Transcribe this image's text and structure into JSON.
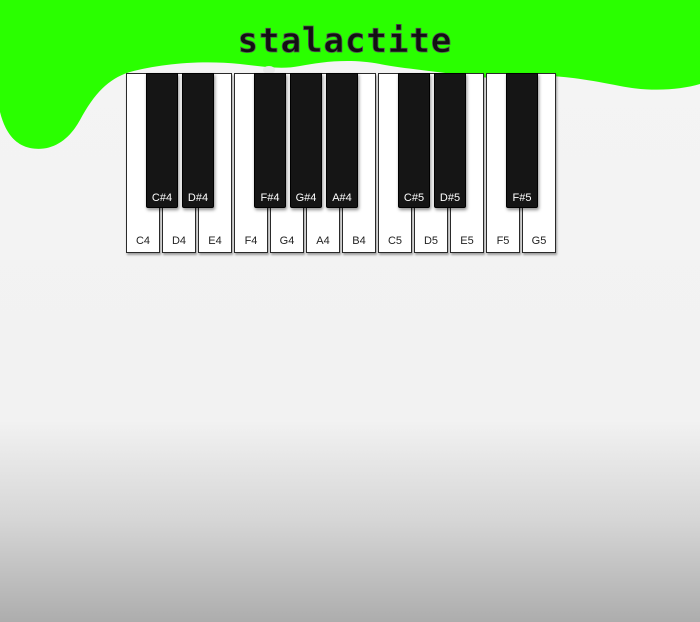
{
  "app": {
    "title": "stalactite"
  },
  "colors": {
    "slime": "#2aff00",
    "background": "#f3f3f3",
    "white_key": "#ffffff",
    "black_key": "#151515"
  },
  "piano": {
    "white_keys": [
      {
        "label": "C4"
      },
      {
        "label": "D4"
      },
      {
        "label": "E4"
      },
      {
        "label": "F4"
      },
      {
        "label": "G4"
      },
      {
        "label": "A4"
      },
      {
        "label": "B4"
      },
      {
        "label": "C5"
      },
      {
        "label": "D5"
      },
      {
        "label": "E5"
      },
      {
        "label": "F5"
      },
      {
        "label": "G5"
      }
    ],
    "black_keys": [
      {
        "label": "C#4"
      },
      {
        "label": "D#4"
      },
      {
        "label": "F#4"
      },
      {
        "label": "G#4"
      },
      {
        "label": "A#4"
      },
      {
        "label": "C#5"
      },
      {
        "label": "D#5"
      },
      {
        "label": "F#5"
      }
    ]
  }
}
